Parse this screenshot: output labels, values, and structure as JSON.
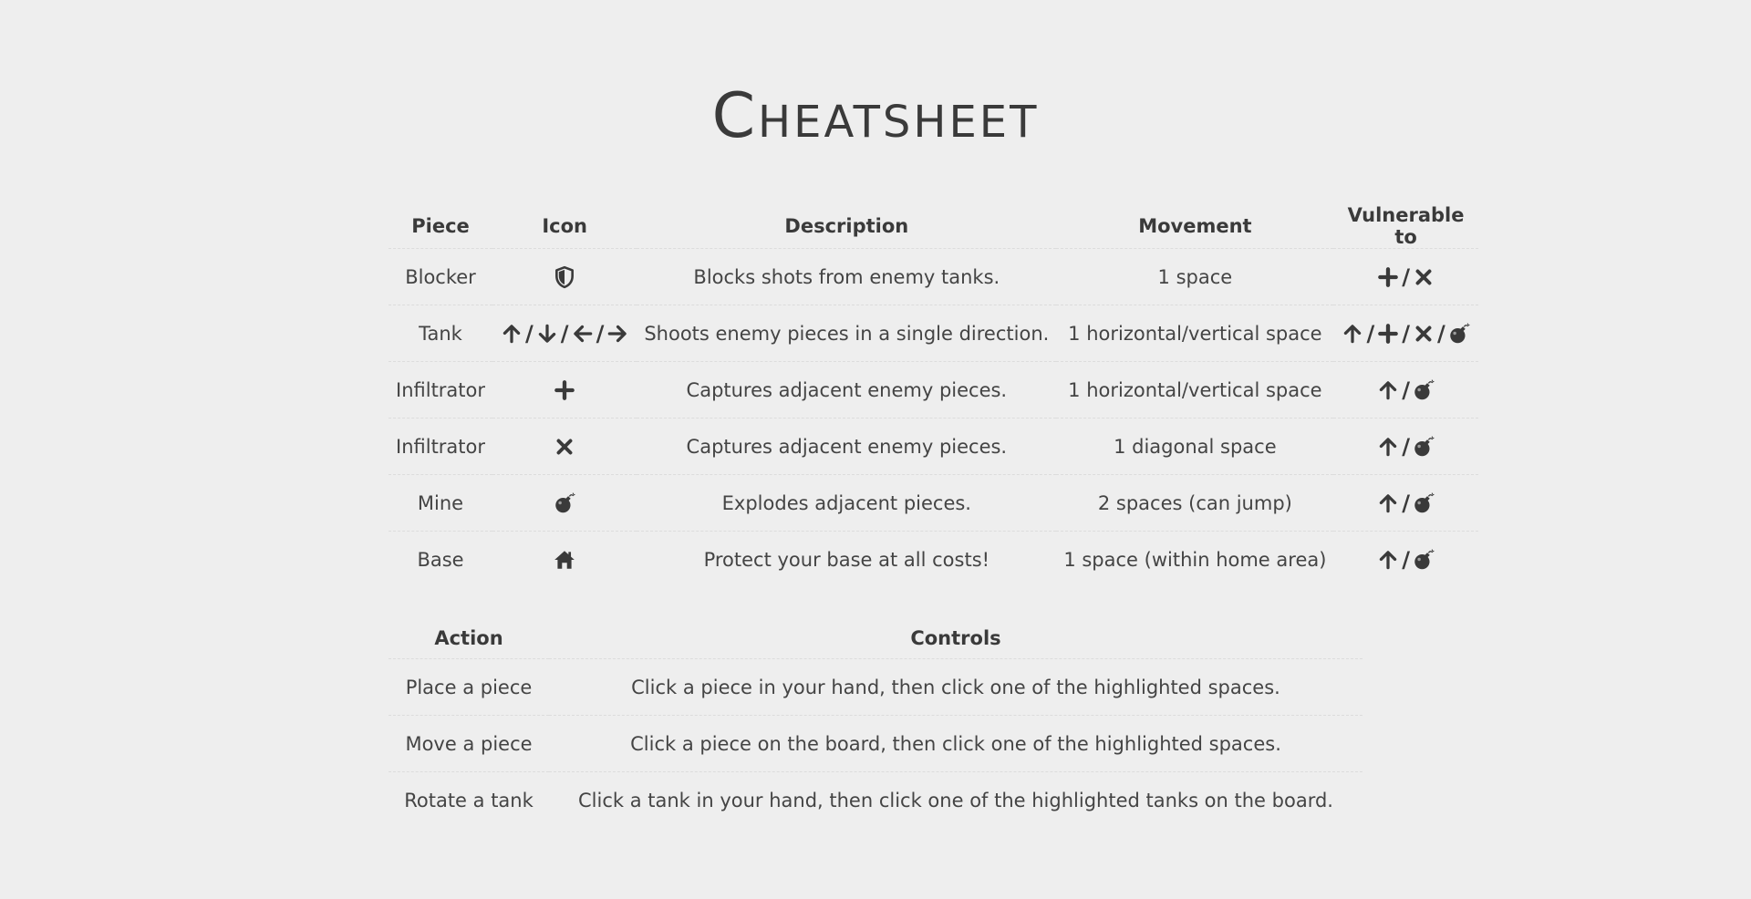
{
  "title": "Cheatsheet",
  "pieces_table": {
    "headers": [
      "Piece",
      "Icon",
      "Description",
      "Movement",
      "Vulnerable to"
    ],
    "rows": [
      {
        "piece": "Blocker",
        "icons": [
          "shield-icon"
        ],
        "description": "Blocks shots from enemy tanks.",
        "movement": "1 space",
        "vulnerable": [
          "plus-icon",
          "x-icon"
        ]
      },
      {
        "piece": "Tank",
        "icons": [
          "arrow-up-icon",
          "arrow-down-icon",
          "arrow-left-icon",
          "arrow-right-icon"
        ],
        "description": "Shoots enemy pieces in a single direction.",
        "movement": "1 horizontal/vertical space",
        "vulnerable": [
          "arrow-up-icon",
          "plus-icon",
          "x-icon",
          "bomb-icon"
        ]
      },
      {
        "piece": "Infiltrator",
        "icons": [
          "plus-icon"
        ],
        "description": "Captures adjacent enemy pieces.",
        "movement": "1 horizontal/vertical space",
        "vulnerable": [
          "arrow-up-icon",
          "bomb-icon"
        ]
      },
      {
        "piece": "Infiltrator",
        "icons": [
          "x-icon"
        ],
        "description": "Captures adjacent enemy pieces.",
        "movement": "1 diagonal space",
        "vulnerable": [
          "arrow-up-icon",
          "bomb-icon"
        ]
      },
      {
        "piece": "Mine",
        "icons": [
          "bomb-icon"
        ],
        "description": "Explodes adjacent pieces.",
        "movement": "2 spaces (can jump)",
        "vulnerable": [
          "arrow-up-icon",
          "bomb-icon"
        ]
      },
      {
        "piece": "Base",
        "icons": [
          "home-icon"
        ],
        "description": "Protect your base at all costs!",
        "movement": "1 space (within home area)",
        "vulnerable": [
          "arrow-up-icon",
          "bomb-icon"
        ]
      }
    ]
  },
  "actions_table": {
    "headers": [
      "Action",
      "Controls"
    ],
    "rows": [
      {
        "action": "Place a piece",
        "controls": "Click a piece in your hand, then click one of the highlighted spaces."
      },
      {
        "action": "Move a piece",
        "controls": "Click a piece on the board, then click one of the highlighted spaces."
      },
      {
        "action": "Rotate a tank",
        "controls": "Click a tank in your hand, then click one of the highlighted tanks on the board."
      }
    ]
  },
  "colors": {
    "background": "#eeeeee",
    "text": "#3a3a3a",
    "divider": "#dcdcdc"
  }
}
